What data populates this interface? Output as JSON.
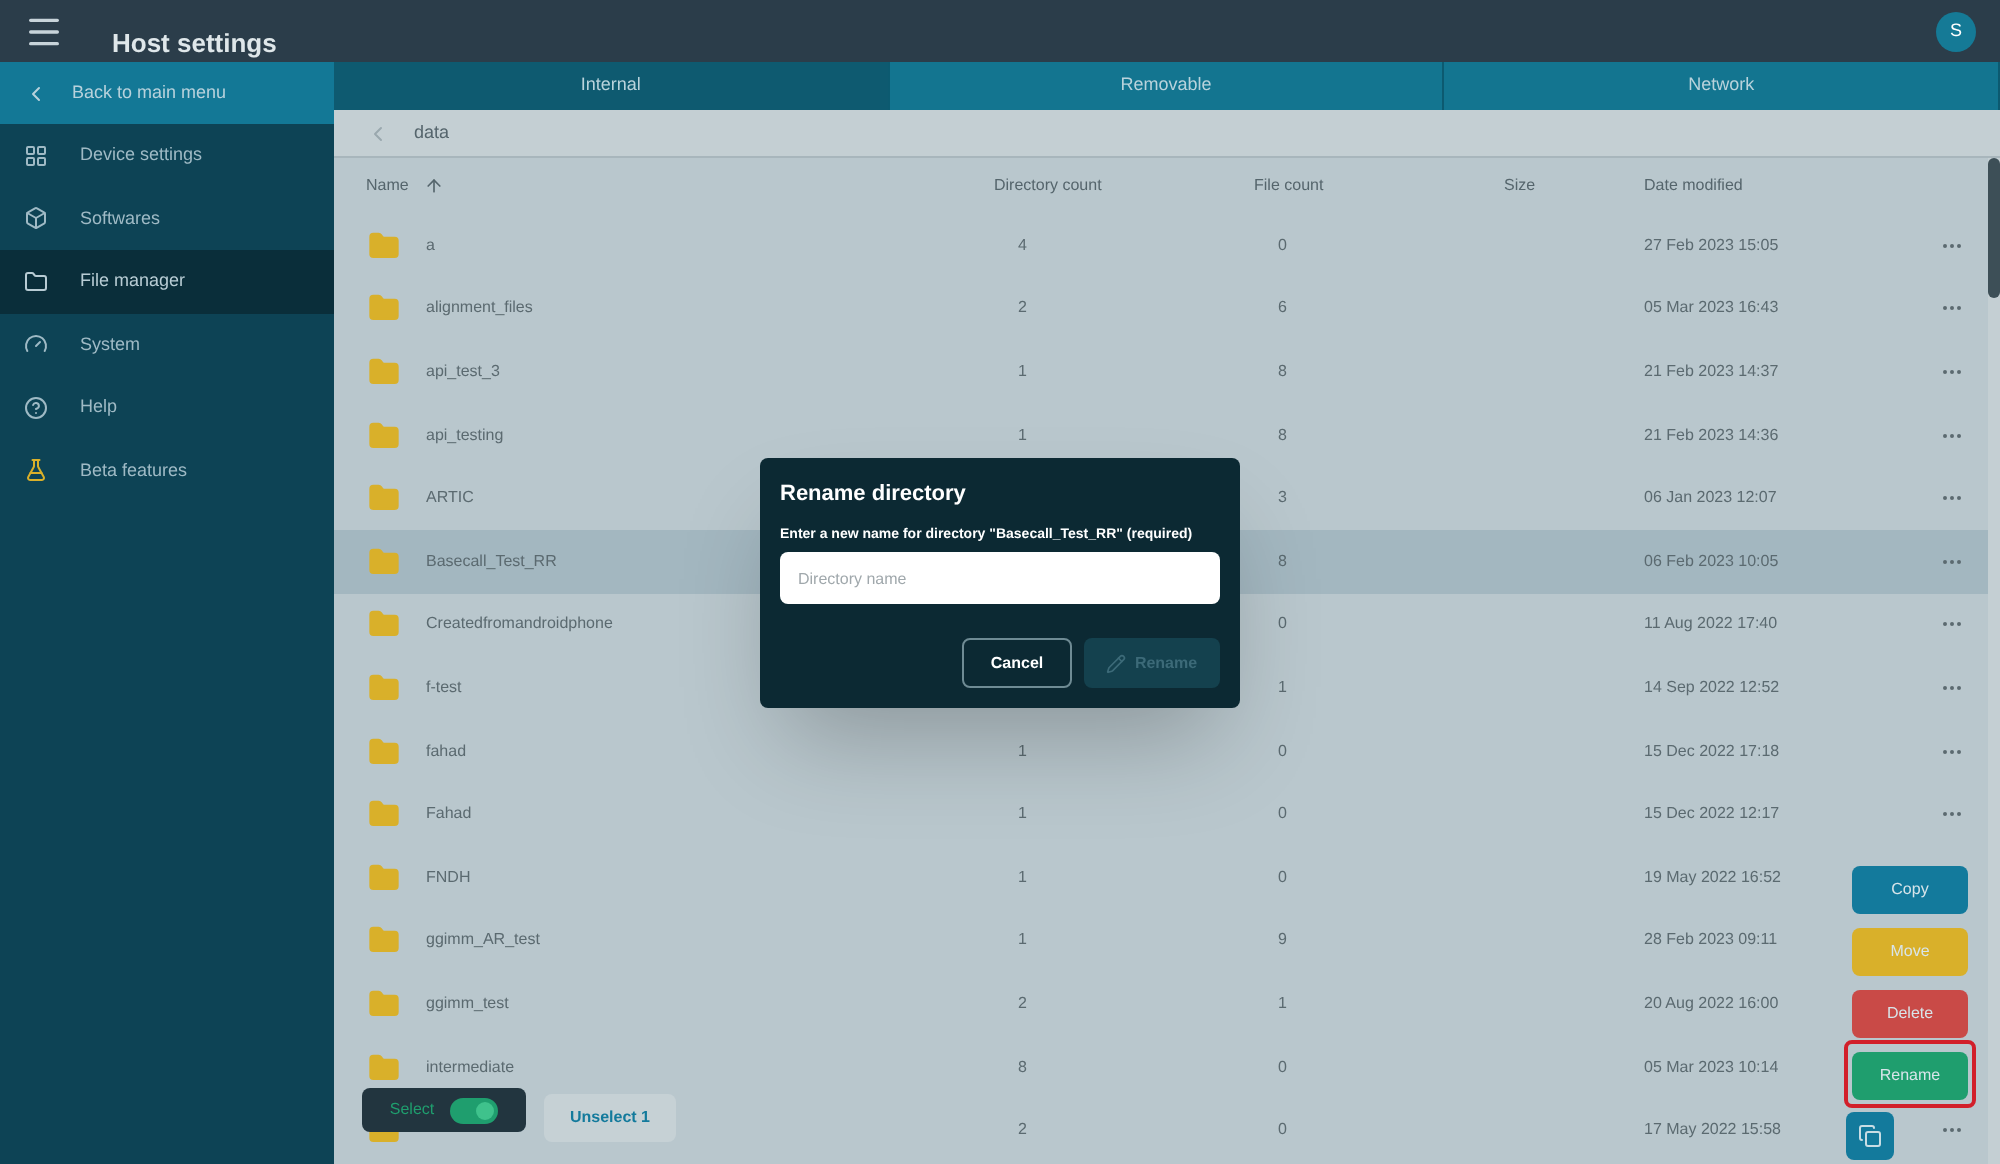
{
  "header": {
    "title": "Host settings",
    "avatar": "S"
  },
  "sidebar": {
    "back": "Back to main menu",
    "items": [
      {
        "label": "Device settings",
        "selected": false
      },
      {
        "label": "Softwares",
        "selected": false
      },
      {
        "label": "File manager",
        "selected": true
      },
      {
        "label": "System",
        "selected": false
      },
      {
        "label": "Help",
        "selected": false
      },
      {
        "label": "Beta features",
        "selected": false
      }
    ]
  },
  "tabs": [
    {
      "label": "Internal",
      "selected": true
    },
    {
      "label": "Removable",
      "selected": false
    },
    {
      "label": "Network",
      "selected": false
    }
  ],
  "breadcrumb": "data",
  "table": {
    "columns": [
      "Name",
      "Directory count",
      "File count",
      "Size",
      "Date modified"
    ],
    "rows": [
      {
        "name": "a",
        "dirs": "4",
        "files": "0",
        "date": "27 Feb 2023 15:05",
        "selected": false,
        "menu": true
      },
      {
        "name": "alignment_files",
        "dirs": "2",
        "files": "6",
        "date": "05 Mar 2023 16:43",
        "selected": false,
        "menu": true
      },
      {
        "name": "api_test_3",
        "dirs": "1",
        "files": "8",
        "date": "21 Feb 2023 14:37",
        "selected": false,
        "menu": true
      },
      {
        "name": "api_testing",
        "dirs": "1",
        "files": "8",
        "date": "21 Feb 2023 14:36",
        "selected": false,
        "menu": true
      },
      {
        "name": "ARTIC",
        "files": "3",
        "date": "06 Jan 2023 12:07",
        "selected": false,
        "menu": true
      },
      {
        "name": "Basecall_Test_RR",
        "files": "8",
        "date": "06 Feb 2023 10:05",
        "selected": true,
        "menu": true
      },
      {
        "name": "Createdfromandroidphone",
        "files": "0",
        "date": "11 Aug 2022 17:40",
        "selected": false,
        "menu": true
      },
      {
        "name": "f-test",
        "files": "1",
        "date": "14 Sep 2022 12:52",
        "selected": false,
        "menu": true
      },
      {
        "name": "fahad",
        "dirs": "1",
        "files": "0",
        "date": "15 Dec 2022 17:18",
        "selected": false,
        "menu": true
      },
      {
        "name": "Fahad",
        "dirs": "1",
        "files": "0",
        "date": "15 Dec 2022 12:17",
        "selected": false,
        "menu": true
      },
      {
        "name": "FNDH",
        "dirs": "1",
        "files": "0",
        "date": "19 May 2022 16:52",
        "selected": false,
        "menu": false
      },
      {
        "name": "ggimm_AR_test",
        "dirs": "1",
        "files": "9",
        "date": "28 Feb 2023 09:11",
        "selected": false,
        "menu": false
      },
      {
        "name": "ggimm_test",
        "dirs": "2",
        "files": "1",
        "date": "20 Aug 2022 16:00",
        "selected": false,
        "menu": false
      },
      {
        "name": "intermediate",
        "dirs": "8",
        "files": "0",
        "date": "05 Mar 2023 10:14",
        "selected": false,
        "menu": false
      },
      {
        "dirs": "2",
        "files": "0",
        "date": "17 May 2022 15:58",
        "selected": false,
        "menu": true
      }
    ]
  },
  "selection": {
    "toggle_label": "Select",
    "on": true,
    "unselect": "Unselect 1"
  },
  "actions": [
    {
      "label": "Copy",
      "color": "#137a9c",
      "highlighted": false
    },
    {
      "label": "Move",
      "color": "#d9b02a",
      "highlighted": false
    },
    {
      "label": "Delete",
      "color": "#c94a47",
      "highlighted": false
    },
    {
      "label": "Rename",
      "color": "#1f9e6e",
      "highlighted": true
    }
  ],
  "dialog": {
    "title": "Rename directory",
    "label": "Enter a new name for directory \"Basecall_Test_RR\" (required)",
    "placeholder": "Directory name",
    "cancel": "Cancel",
    "confirm": "Rename",
    "confirm_disabled": true
  }
}
